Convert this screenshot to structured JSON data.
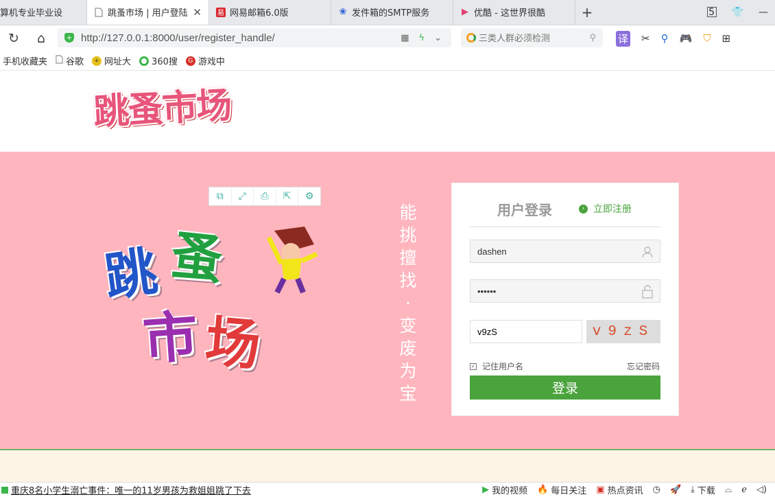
{
  "tabs": [
    {
      "title": "算机专业毕业设",
      "favicon": "",
      "active": false
    },
    {
      "title": "跳蚤市场 | 用户登陆",
      "favicon": "page-icon",
      "active": true
    },
    {
      "title": "网易邮箱6.0版",
      "favicon": "netease-icon",
      "active": false
    },
    {
      "title": "发件箱的SMTP服务",
      "favicon": "baidu-paw-icon",
      "active": false
    },
    {
      "title": "优酷 - 这世界很酷",
      "favicon": "youku-icon",
      "active": false
    }
  ],
  "tabbar_right": {
    "badge": "5"
  },
  "address": {
    "url": "http://127.0.0.1:8000/user/register_handle/"
  },
  "search": {
    "placeholder": "三类人群必须检测"
  },
  "extensions": {
    "translate": "译"
  },
  "bookmarks": [
    {
      "label": "手机收藏夹",
      "icon": ""
    },
    {
      "label": "谷歌",
      "icon": "page-icon"
    },
    {
      "label": "网址大",
      "icon": "plus-circle-icon"
    },
    {
      "label": "360搜",
      "icon": "360-icon"
    },
    {
      "label": "游戏中",
      "icon": "game-icon"
    }
  ],
  "header": {
    "logo_text": "跳蚤市场"
  },
  "banner": {
    "big_logo": {
      "line1": [
        "跳",
        "蚤"
      ],
      "line2": [
        "市",
        "场"
      ]
    },
    "slogan": "能挑擅找·变废为宝"
  },
  "login": {
    "title": "用户登录",
    "register_link": "立即注册",
    "username_value": "dashen",
    "password_value": "••••••",
    "captcha_value": "v9zS",
    "captcha_image_text": "v9zS",
    "remember_label": "记住用户名",
    "remember_checked": true,
    "forgot_label": "忘记密码",
    "submit_label": "登录"
  },
  "statusbar": {
    "news": "重庆8名小学生溺亡事件：唯一的11岁男孩为救姐姐跳了下去",
    "items": [
      "我的视频",
      "每日关注",
      "热点资讯"
    ],
    "download": "下载"
  },
  "colors": {
    "banner_bg": "#ffb5be",
    "accent_green": "#4aa33c",
    "footer_bg": "#fdf4e6"
  }
}
